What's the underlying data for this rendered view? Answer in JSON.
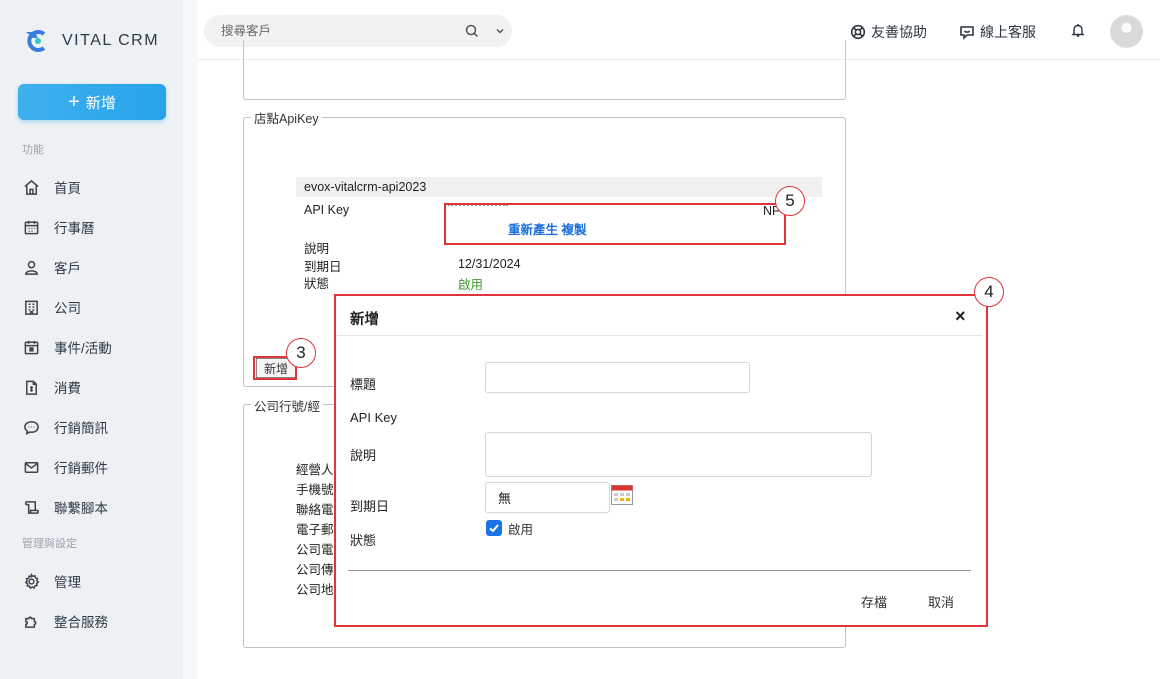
{
  "brand": {
    "name": "VITAL CRM"
  },
  "sidebar": {
    "new_button": "新增",
    "section_functions": "功能",
    "section_admin": "管理與設定",
    "items": [
      {
        "label": "首頁",
        "icon": "home-icon"
      },
      {
        "label": "行事曆",
        "icon": "calendar-icon"
      },
      {
        "label": "客戶",
        "icon": "user-icon"
      },
      {
        "label": "公司",
        "icon": "building-icon"
      },
      {
        "label": "事件/活動",
        "icon": "event-icon"
      },
      {
        "label": "消費",
        "icon": "receipt-icon"
      },
      {
        "label": "行銷簡訊",
        "icon": "sms-icon"
      },
      {
        "label": "行銷郵件",
        "icon": "mail-icon"
      },
      {
        "label": "聯繫腳本",
        "icon": "script-icon"
      }
    ],
    "admin_items": [
      {
        "label": "管理",
        "icon": "gear-icon"
      },
      {
        "label": "整合服務",
        "icon": "puzzle-icon"
      }
    ]
  },
  "header": {
    "search_placeholder": "搜尋客戶",
    "help_label": "友善協助",
    "support_label": "線上客服"
  },
  "apikey_section": {
    "legend": "店點ApiKey",
    "key_name": "evox-vitalcrm-api2023",
    "api_key_label": "API Key",
    "regenerate_label": "重新產生",
    "copy_label": "複製",
    "truncated_suffix": "NF",
    "desc_label": "說明",
    "expiry_label": "到期日",
    "expiry_value": "12/31/2024",
    "status_label": "狀態",
    "status_value": "啟用",
    "add_button": "新增"
  },
  "company_section": {
    "legend": "公司行號/經",
    "rows": [
      "經營人",
      "手機號",
      "聯絡電",
      "電子郵",
      "公司電",
      "公司傳",
      "公司地"
    ]
  },
  "annotations": {
    "three": "3",
    "four": "4",
    "five": "5"
  },
  "modal": {
    "title": "新增",
    "close": "×",
    "title_label": "標題",
    "apikey_label": "API Key",
    "desc_label": "說明",
    "expiry_label": "到期日",
    "expiry_value": "無",
    "status_label": "狀態",
    "enabled_label": "啟用",
    "save_button": "存檔",
    "cancel_button": "取消"
  },
  "colors": {
    "accent": "#27a3ea",
    "annotation": "#e0333a",
    "link": "#1e6fd9",
    "enabled": "#3c9a2e"
  }
}
